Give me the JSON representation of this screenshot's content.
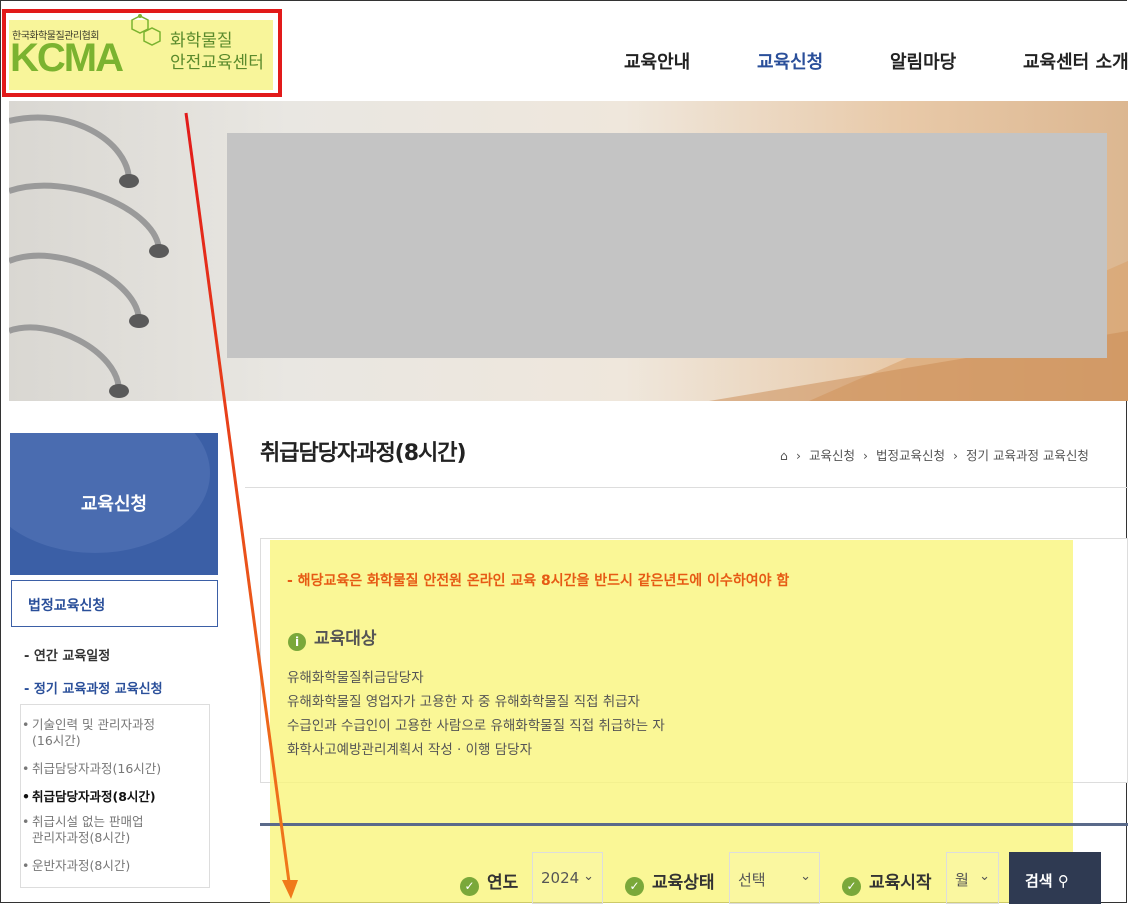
{
  "header": {
    "logo_sub": "한국화학물질관리협회",
    "logo_main": "KCMA",
    "logo_title_1": "화학물질",
    "logo_title_2": "안전교육센터",
    "nav": [
      "교육안내",
      "교육신청",
      "알림마당",
      "교육센터 소개"
    ],
    "nav_active_index": 1
  },
  "sidebar": {
    "title": "교육신청",
    "active_group": "법정교육신청",
    "items": [
      "- 연간 교육일정",
      "- 정기 교육과정 교육신청"
    ],
    "sub_items": [
      "기술인력 및 관리자과정\n(16시간)",
      "취급담당자과정(16시간)",
      "취급담당자과정(8시간)",
      "취급시설 없는 판매업\n관리자과정(8시간)",
      "운반자과정(8시간)"
    ],
    "sub_current_index": 2
  },
  "main": {
    "title": "취급담당자과정(8시간)",
    "breadcrumb": [
      "교육신청",
      "법정교육신청",
      "정기 교육과정 교육신청"
    ],
    "notice": "- 해당교육은 화학물질 안전원 온라인 교육 8시간을 반드시 같은년도에 이수하여야 함",
    "target_heading": "교육대상",
    "targets": [
      "유해화학물질취급담당자",
      "유해화학물질 영업자가 고용한 자 중 유해화학물질 직접 취급자",
      "수급인과 수급인이 고용한 사람으로 유해화학물질 직접 취급하는 자",
      "화학사고예방관리계획서 작성 · 이행 담당자"
    ]
  },
  "filters": {
    "year_label": "연도",
    "year_value": "2024",
    "status_label": "교육상태",
    "status_value": "선택",
    "start_label": "교육시작",
    "start_value": "월",
    "search_label": "검색"
  },
  "colors": {
    "brand_green": "#7bb330",
    "nav_active": "#2a4f9a",
    "sidebar_blue": "#3b5fa6",
    "notice_orange": "#e65a14",
    "highlight_yellow": "#f8f59a",
    "annotation_red": "#e21a1a"
  }
}
